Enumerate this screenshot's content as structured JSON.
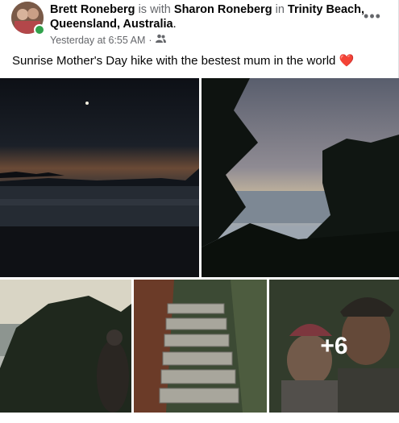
{
  "post": {
    "author": "Brett Roneberg",
    "connector_with": "is with",
    "tagged": "Sharon Roneberg",
    "connector_in": "in",
    "location": "Trinity Beach, Queensland, Australia",
    "location_end": ".",
    "timestamp": "Yesterday at 6:55 AM",
    "separator": "·",
    "privacy_icon": "friends-icon",
    "caption": "Sunrise Mother's Day hike with the bestest mum in the world",
    "caption_emoji": "❤️",
    "more_photos_label": "+6"
  },
  "colors": {
    "link": "#050505",
    "muted": "#65676b",
    "online": "#31a24c",
    "heart": "#e41e3f"
  }
}
